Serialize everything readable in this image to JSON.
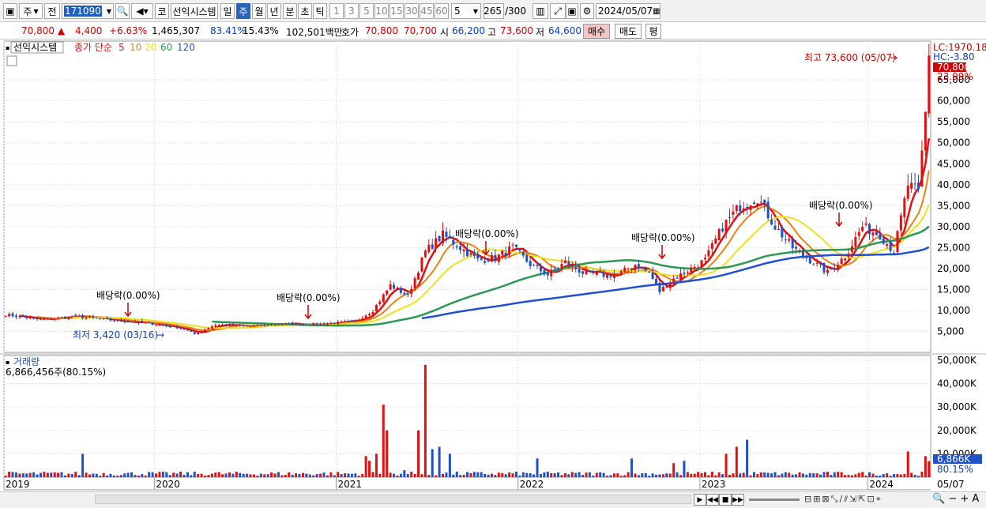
{
  "toolbar": {
    "menu_label": "주",
    "jeon_label": "전",
    "stock_code": "171090",
    "ko_label": "코",
    "stock_name": "선익시스템",
    "periods": [
      "일",
      "주",
      "월",
      "년",
      "분",
      "초",
      "틱"
    ],
    "active_period": "주",
    "intervals": [
      "1",
      "3",
      "5",
      "10",
      "15",
      "30",
      "45",
      "60"
    ],
    "interval_value": "5",
    "count_value": "265",
    "count_total": "/300",
    "date": "2024/05/07"
  },
  "info": {
    "price": "70,800",
    "change": "4,400",
    "change_pct": "+6.63%",
    "volume": "1,465,307",
    "vol_ratio": "83.41%",
    "turnover": "15.43%",
    "amount": "102,501백만",
    "hoga_label": "호가",
    "hoga_ask": "70,800",
    "hoga_bid": "70,700",
    "open_label": "시",
    "open": "66,200",
    "high_label": "고",
    "high": "73,600",
    "low_label": "저",
    "low": "64,600",
    "buy_label": "매수",
    "sell_label": "매도",
    "eval_label": "평"
  },
  "legend": {
    "name": "선익시스템",
    "ma_title": "종가 단순",
    "periods": [
      "5",
      "10",
      "20",
      "60",
      "120"
    ],
    "colors": [
      "#e01010",
      "#f08010",
      "#f0e020",
      "#2a9a50",
      "#2050d0"
    ]
  },
  "price_axis": {
    "ticks": [
      "65,000",
      "60,000",
      "55,000",
      "50,000",
      "45,000",
      "40,000",
      "35,000",
      "30,000",
      "25,000",
      "20,000",
      "15,000",
      "10,000",
      "5,000"
    ],
    "lc": "LC:1970.18",
    "hc": "HC:-3.80",
    "last": "70,800",
    "last_pct": "23.99%"
  },
  "annotations": {
    "high": "최고 73,600 (05/07)",
    "low": "최저 3,420 (03/16)",
    "dividend": "배당락(0.00%)"
  },
  "volume_panel": {
    "title": "거래량",
    "value": "6,866,456주(80.15%)",
    "ticks": [
      "50,000K",
      "40,000K",
      "30,000K",
      "20,000K",
      "10,000K"
    ],
    "last": "6,866K",
    "last_pct": "80.15%"
  },
  "x_axis": {
    "labels": [
      "2019",
      "2020",
      "2021",
      "2022",
      "2023",
      "2024"
    ],
    "last_date": "05/07"
  },
  "chart_data": {
    "type": "candlestick",
    "timeframe": "weekly",
    "y_range": [
      0,
      72000
    ],
    "price_ticks": [
      5000,
      10000,
      15000,
      20000,
      25000,
      30000,
      35000,
      40000,
      45000,
      50000,
      55000,
      60000,
      65000
    ],
    "volume_range_k": [
      0,
      52000
    ],
    "x_years": [
      "2019",
      "2020",
      "2021",
      "2022",
      "2023",
      "2024"
    ],
    "close_anchors": [
      [
        0,
        9000
      ],
      [
        10,
        7800
      ],
      [
        20,
        8600
      ],
      [
        30,
        7700
      ],
      [
        40,
        7000
      ],
      [
        50,
        5800
      ],
      [
        54,
        4400
      ],
      [
        60,
        6600
      ],
      [
        70,
        6200
      ],
      [
        80,
        6800
      ],
      [
        90,
        6700
      ],
      [
        100,
        7400
      ],
      [
        105,
        10000
      ],
      [
        110,
        16000
      ],
      [
        115,
        13500
      ],
      [
        120,
        24000
      ],
      [
        125,
        28000
      ],
      [
        130,
        25000
      ],
      [
        135,
        22000
      ],
      [
        140,
        22500
      ],
      [
        145,
        25000
      ],
      [
        150,
        21000
      ],
      [
        155,
        18500
      ],
      [
        160,
        21500
      ],
      [
        165,
        19000
      ],
      [
        170,
        18500
      ],
      [
        175,
        18500
      ],
      [
        180,
        21000
      ],
      [
        184,
        19000
      ],
      [
        187,
        14500
      ],
      [
        190,
        17000
      ],
      [
        195,
        19500
      ],
      [
        200,
        22000
      ],
      [
        205,
        30000
      ],
      [
        210,
        35000
      ],
      [
        215,
        37000
      ],
      [
        220,
        30000
      ],
      [
        225,
        25000
      ],
      [
        230,
        22000
      ],
      [
        235,
        19000
      ],
      [
        240,
        23000
      ],
      [
        245,
        30000
      ],
      [
        250,
        28000
      ],
      [
        254,
        24000
      ],
      [
        258,
        40000
      ],
      [
        261,
        38000
      ],
      [
        263,
        57000
      ],
      [
        264,
        70800
      ]
    ],
    "volume_spikes_k": [
      [
        22,
        10000
      ],
      [
        103,
        9000
      ],
      [
        104,
        7000
      ],
      [
        106,
        10000
      ],
      [
        108,
        31000
      ],
      [
        109,
        20000
      ],
      [
        114,
        3000
      ],
      [
        118,
        20000
      ],
      [
        120,
        48000
      ],
      [
        122,
        12000
      ],
      [
        124,
        13000
      ],
      [
        127,
        10000
      ],
      [
        152,
        8000
      ],
      [
        179,
        8000
      ],
      [
        191,
        6000
      ],
      [
        194,
        7000
      ],
      [
        206,
        10000
      ],
      [
        209,
        13000
      ],
      [
        212,
        16000
      ],
      [
        258,
        11000
      ],
      [
        263,
        9000
      ],
      [
        264,
        6866
      ]
    ],
    "ma_periods": [
      5,
      10,
      20,
      60,
      120
    ],
    "last_close": 70800,
    "high": 73600,
    "low": 3420
  }
}
